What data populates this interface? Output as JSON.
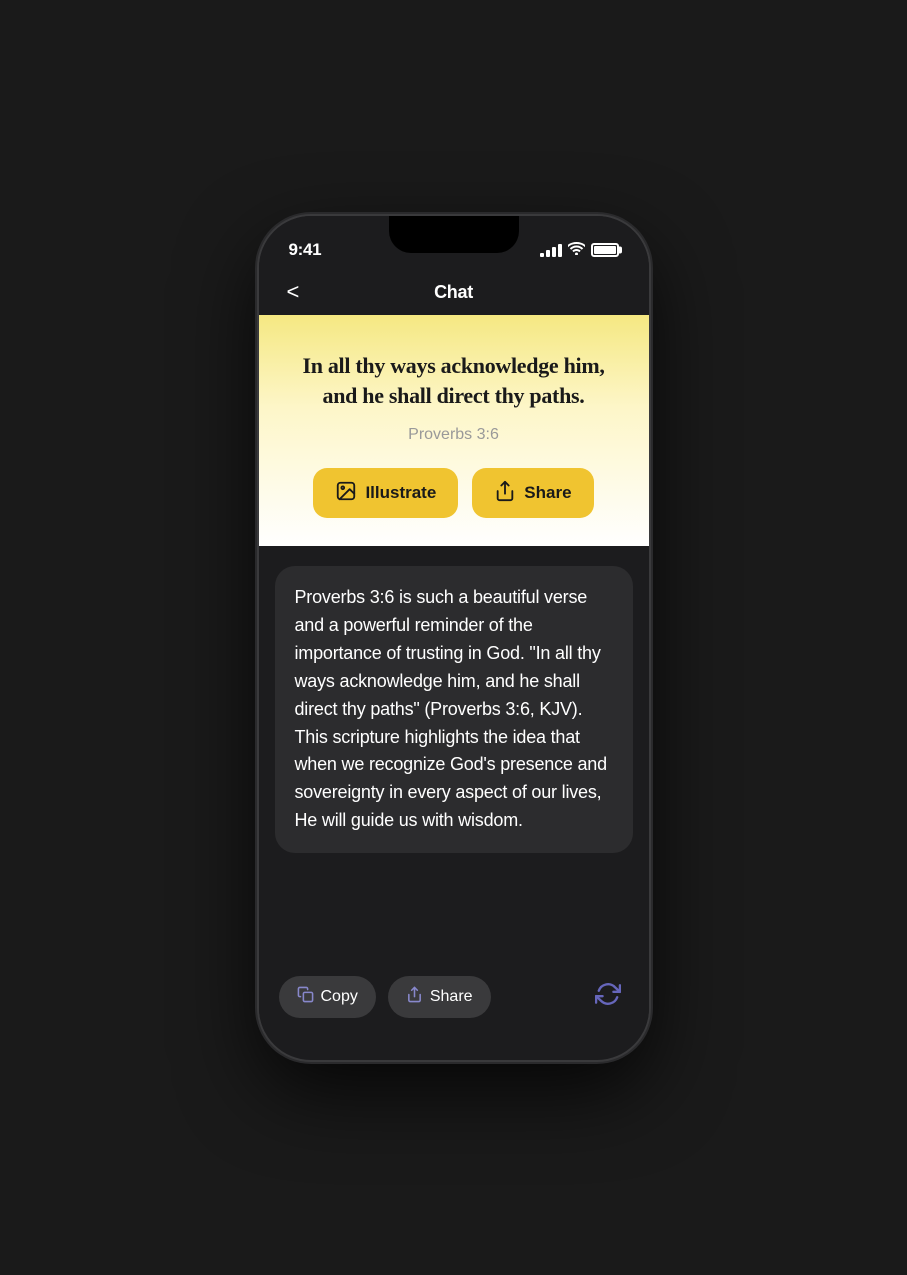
{
  "status_bar": {
    "time": "9:41"
  },
  "nav": {
    "back_label": "<",
    "title": "Chat"
  },
  "verse_card": {
    "verse_text": "In all thy ways acknowledge him, and he shall direct thy paths.",
    "verse_ref": "Proverbs 3:6",
    "btn_illustrate": "Illustrate",
    "btn_share": "Share"
  },
  "chat": {
    "bubble_text": "Proverbs 3:6 is such a beautiful verse and a powerful reminder of the importance of trusting in God. \"In all thy ways acknowledge him, and he shall direct thy paths\" (Proverbs 3:6, KJV). This scripture highlights the idea that when we recognize God's presence and sovereignty in every aspect of our lives, He will guide us with wisdom."
  },
  "bottom_actions": {
    "copy_label": "Copy",
    "share_label": "Share"
  }
}
